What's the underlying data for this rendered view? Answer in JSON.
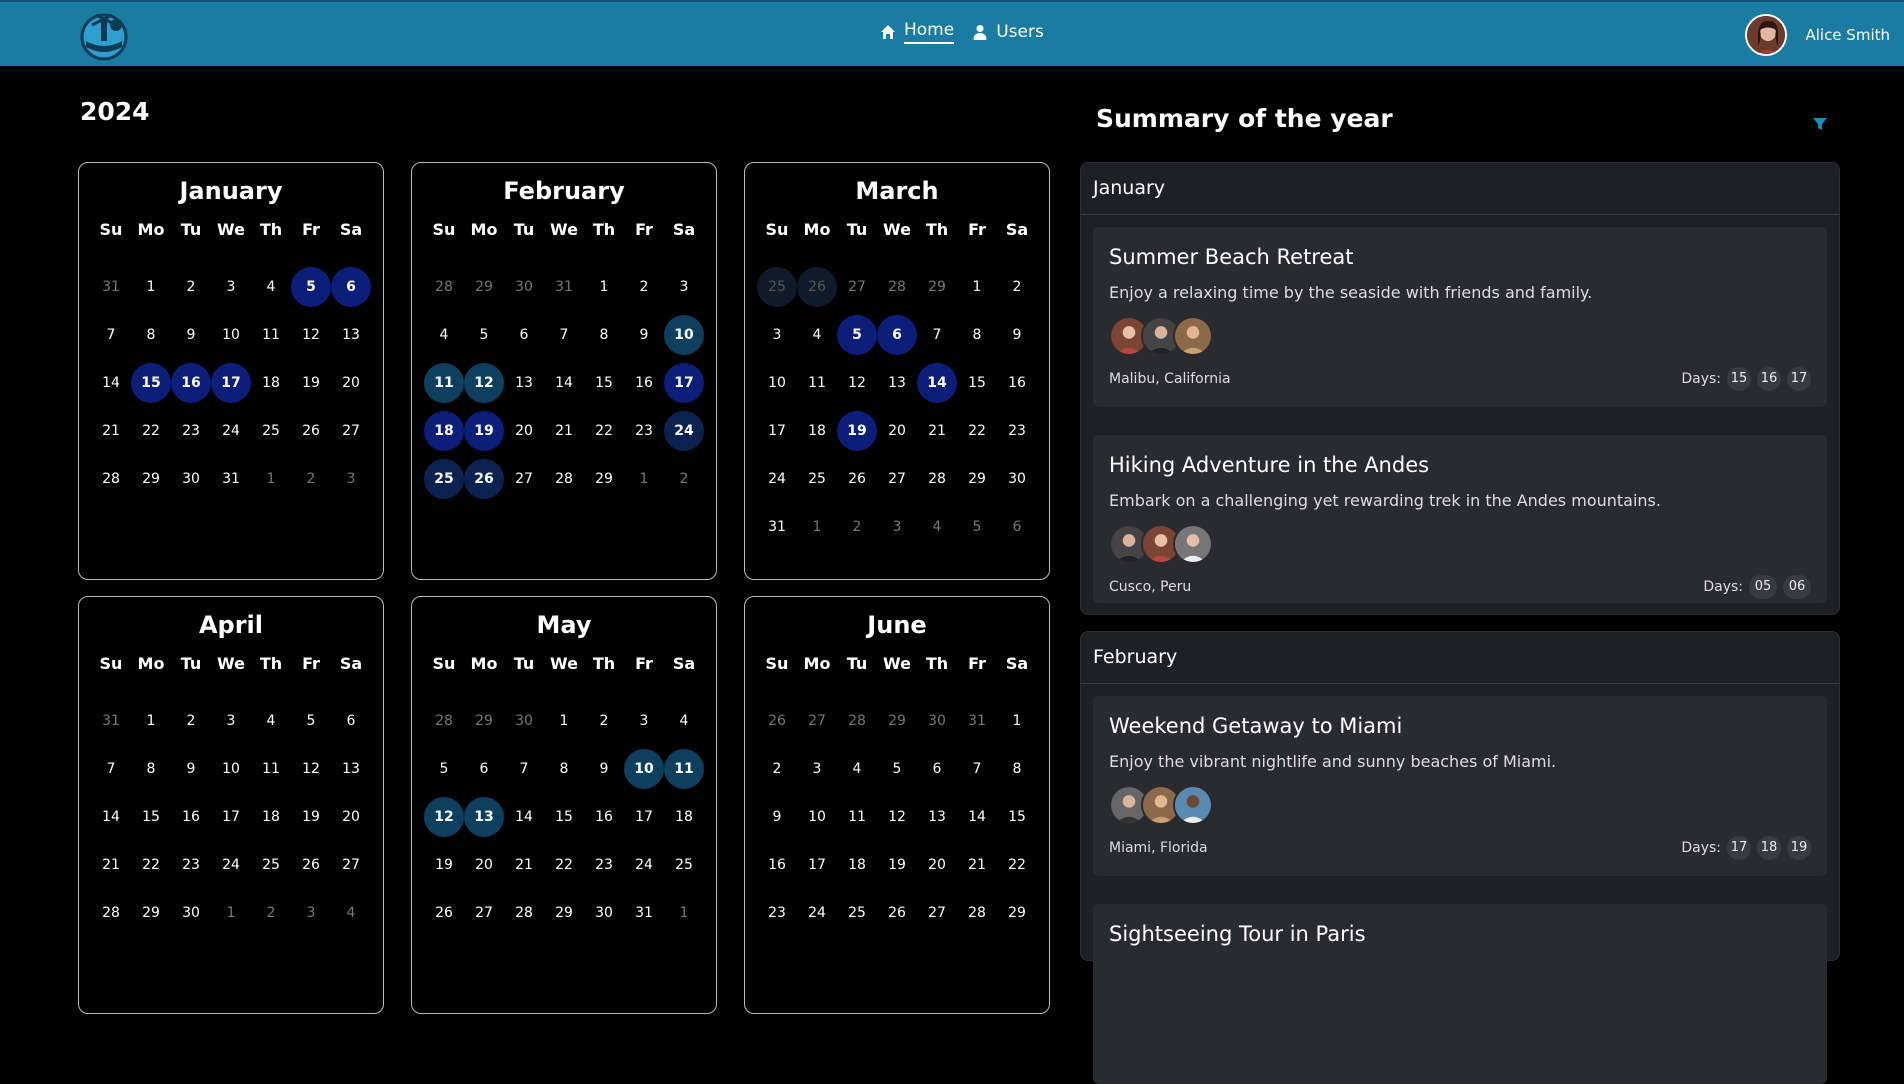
{
  "nav": {
    "home_label": "Home",
    "users_label": "Users",
    "user_name": "Alice Smith"
  },
  "calendar": {
    "year": "2024",
    "weekdays": [
      "Su",
      "Mo",
      "Tu",
      "We",
      "Th",
      "Fr",
      "Sa"
    ],
    "months": [
      {
        "name": "January",
        "weeks": [
          [
            [
              "31",
              "m"
            ],
            [
              "1",
              ""
            ],
            [
              "2",
              ""
            ],
            [
              "3",
              ""
            ],
            [
              "4",
              ""
            ],
            [
              "5",
              "b"
            ],
            [
              "6",
              "b"
            ]
          ],
          [
            [
              "7",
              ""
            ],
            [
              "8",
              ""
            ],
            [
              "9",
              ""
            ],
            [
              "10",
              ""
            ],
            [
              "11",
              ""
            ],
            [
              "12",
              ""
            ],
            [
              "13",
              ""
            ]
          ],
          [
            [
              "14",
              ""
            ],
            [
              "15",
              "b"
            ],
            [
              "16",
              "b"
            ],
            [
              "17",
              "b"
            ],
            [
              "18",
              ""
            ],
            [
              "19",
              ""
            ],
            [
              "20",
              ""
            ]
          ],
          [
            [
              "21",
              ""
            ],
            [
              "22",
              ""
            ],
            [
              "23",
              ""
            ],
            [
              "24",
              ""
            ],
            [
              "25",
              ""
            ],
            [
              "26",
              ""
            ],
            [
              "27",
              ""
            ]
          ],
          [
            [
              "28",
              ""
            ],
            [
              "29",
              ""
            ],
            [
              "30",
              ""
            ],
            [
              "31",
              ""
            ],
            [
              "1",
              "m"
            ],
            [
              "2",
              "m"
            ],
            [
              "3",
              "m"
            ]
          ]
        ]
      },
      {
        "name": "February",
        "weeks": [
          [
            [
              "28",
              "m"
            ],
            [
              "29",
              "m"
            ],
            [
              "30",
              "m"
            ],
            [
              "31",
              "m"
            ],
            [
              "1",
              ""
            ],
            [
              "2",
              ""
            ],
            [
              "3",
              ""
            ]
          ],
          [
            [
              "4",
              ""
            ],
            [
              "5",
              ""
            ],
            [
              "6",
              ""
            ],
            [
              "7",
              ""
            ],
            [
              "8",
              ""
            ],
            [
              "9",
              ""
            ],
            [
              "10",
              "t"
            ]
          ],
          [
            [
              "11",
              "t"
            ],
            [
              "12",
              "t"
            ],
            [
              "13",
              ""
            ],
            [
              "14",
              ""
            ],
            [
              "15",
              ""
            ],
            [
              "16",
              ""
            ],
            [
              "17",
              "b"
            ]
          ],
          [
            [
              "18",
              "b"
            ],
            [
              "19",
              "b"
            ],
            [
              "20",
              ""
            ],
            [
              "21",
              ""
            ],
            [
              "22",
              ""
            ],
            [
              "23",
              ""
            ],
            [
              "24",
              "n"
            ]
          ],
          [
            [
              "25",
              "n"
            ],
            [
              "26",
              "n"
            ],
            [
              "27",
              ""
            ],
            [
              "28",
              ""
            ],
            [
              "29",
              ""
            ],
            [
              "1",
              "m"
            ],
            [
              "2",
              "m"
            ]
          ]
        ]
      },
      {
        "name": "March",
        "weeks": [
          [
            [
              "25",
              "f"
            ],
            [
              "26",
              "f"
            ],
            [
              "27",
              "m"
            ],
            [
              "28",
              "m"
            ],
            [
              "29",
              "m"
            ],
            [
              "1",
              ""
            ],
            [
              "2",
              ""
            ]
          ],
          [
            [
              "3",
              ""
            ],
            [
              "4",
              ""
            ],
            [
              "5",
              "b"
            ],
            [
              "6",
              "b"
            ],
            [
              "7",
              ""
            ],
            [
              "8",
              ""
            ],
            [
              "9",
              ""
            ]
          ],
          [
            [
              "10",
              ""
            ],
            [
              "11",
              ""
            ],
            [
              "12",
              ""
            ],
            [
              "13",
              ""
            ],
            [
              "14",
              "b"
            ],
            [
              "15",
              ""
            ],
            [
              "16",
              ""
            ]
          ],
          [
            [
              "17",
              ""
            ],
            [
              "18",
              ""
            ],
            [
              "19",
              "b"
            ],
            [
              "20",
              ""
            ],
            [
              "21",
              ""
            ],
            [
              "22",
              ""
            ],
            [
              "23",
              ""
            ]
          ],
          [
            [
              "24",
              ""
            ],
            [
              "25",
              ""
            ],
            [
              "26",
              ""
            ],
            [
              "27",
              ""
            ],
            [
              "28",
              ""
            ],
            [
              "29",
              ""
            ],
            [
              "30",
              ""
            ]
          ],
          [
            [
              "31",
              ""
            ],
            [
              "1",
              "m"
            ],
            [
              "2",
              "m"
            ],
            [
              "3",
              "m"
            ],
            [
              "4",
              "m"
            ],
            [
              "5",
              "m"
            ],
            [
              "6",
              "m"
            ]
          ]
        ]
      },
      {
        "name": "April",
        "weeks": [
          [
            [
              "31",
              "m"
            ],
            [
              "1",
              ""
            ],
            [
              "2",
              ""
            ],
            [
              "3",
              ""
            ],
            [
              "4",
              ""
            ],
            [
              "5",
              ""
            ],
            [
              "6",
              ""
            ]
          ],
          [
            [
              "7",
              ""
            ],
            [
              "8",
              ""
            ],
            [
              "9",
              ""
            ],
            [
              "10",
              ""
            ],
            [
              "11",
              ""
            ],
            [
              "12",
              ""
            ],
            [
              "13",
              ""
            ]
          ],
          [
            [
              "14",
              ""
            ],
            [
              "15",
              ""
            ],
            [
              "16",
              ""
            ],
            [
              "17",
              ""
            ],
            [
              "18",
              ""
            ],
            [
              "19",
              ""
            ],
            [
              "20",
              ""
            ]
          ],
          [
            [
              "21",
              ""
            ],
            [
              "22",
              ""
            ],
            [
              "23",
              ""
            ],
            [
              "24",
              ""
            ],
            [
              "25",
              ""
            ],
            [
              "26",
              ""
            ],
            [
              "27",
              ""
            ]
          ],
          [
            [
              "28",
              ""
            ],
            [
              "29",
              ""
            ],
            [
              "30",
              ""
            ],
            [
              "1",
              "m"
            ],
            [
              "2",
              "m"
            ],
            [
              "3",
              "m"
            ],
            [
              "4",
              "m"
            ]
          ]
        ]
      },
      {
        "name": "May",
        "weeks": [
          [
            [
              "28",
              "m"
            ],
            [
              "29",
              "m"
            ],
            [
              "30",
              "m"
            ],
            [
              "1",
              ""
            ],
            [
              "2",
              ""
            ],
            [
              "3",
              ""
            ],
            [
              "4",
              ""
            ]
          ],
          [
            [
              "5",
              ""
            ],
            [
              "6",
              ""
            ],
            [
              "7",
              ""
            ],
            [
              "8",
              ""
            ],
            [
              "9",
              ""
            ],
            [
              "10",
              "t"
            ],
            [
              "11",
              "t"
            ]
          ],
          [
            [
              "12",
              "t"
            ],
            [
              "13",
              "t"
            ],
            [
              "14",
              ""
            ],
            [
              "15",
              ""
            ],
            [
              "16",
              ""
            ],
            [
              "17",
              ""
            ],
            [
              "18",
              ""
            ]
          ],
          [
            [
              "19",
              ""
            ],
            [
              "20",
              ""
            ],
            [
              "21",
              ""
            ],
            [
              "22",
              ""
            ],
            [
              "23",
              ""
            ],
            [
              "24",
              ""
            ],
            [
              "25",
              ""
            ]
          ],
          [
            [
              "26",
              ""
            ],
            [
              "27",
              ""
            ],
            [
              "28",
              ""
            ],
            [
              "29",
              ""
            ],
            [
              "30",
              ""
            ],
            [
              "31",
              ""
            ],
            [
              "1",
              "m"
            ]
          ]
        ]
      },
      {
        "name": "June",
        "weeks": [
          [
            [
              "26",
              "m"
            ],
            [
              "27",
              "m"
            ],
            [
              "28",
              "m"
            ],
            [
              "29",
              "m"
            ],
            [
              "30",
              "m"
            ],
            [
              "31",
              "m"
            ],
            [
              "1",
              ""
            ]
          ],
          [
            [
              "2",
              ""
            ],
            [
              "3",
              ""
            ],
            [
              "4",
              ""
            ],
            [
              "5",
              ""
            ],
            [
              "6",
              ""
            ],
            [
              "7",
              ""
            ],
            [
              "8",
              ""
            ]
          ],
          [
            [
              "9",
              ""
            ],
            [
              "10",
              ""
            ],
            [
              "11",
              ""
            ],
            [
              "12",
              ""
            ],
            [
              "13",
              ""
            ],
            [
              "14",
              ""
            ],
            [
              "15",
              ""
            ]
          ],
          [
            [
              "16",
              ""
            ],
            [
              "17",
              ""
            ],
            [
              "18",
              ""
            ],
            [
              "19",
              ""
            ],
            [
              "20",
              ""
            ],
            [
              "21",
              ""
            ],
            [
              "22",
              ""
            ]
          ],
          [
            [
              "23",
              ""
            ],
            [
              "24",
              ""
            ],
            [
              "25",
              ""
            ],
            [
              "26",
              ""
            ],
            [
              "27",
              ""
            ],
            [
              "28",
              ""
            ],
            [
              "29",
              ""
            ]
          ]
        ]
      }
    ]
  },
  "summary": {
    "title": "Summary of the year",
    "january": {
      "label": "January",
      "trips": [
        {
          "title": "Summer Beach Retreat",
          "desc": "Enjoy a relaxing time by the seaside with friends and family.",
          "location": "Malibu, California",
          "days_label": "Days:",
          "days": [
            "15",
            "16",
            "17"
          ]
        },
        {
          "title": "Hiking Adventure in the Andes",
          "desc": "Embark on a challenging yet rewarding trek in the Andes mountains.",
          "location": "Cusco, Peru",
          "days_label": "Days:",
          "days": [
            "05",
            "06"
          ]
        }
      ]
    },
    "february": {
      "label": "February",
      "trips": [
        {
          "title": "Weekend Getaway to Miami",
          "desc": "Enjoy the vibrant nightlife and sunny beaches of Miami.",
          "location": "Miami, Florida",
          "days_label": "Days:",
          "days": [
            "17",
            "18",
            "19"
          ]
        },
        {
          "title": "Sightseeing Tour in Paris"
        }
      ]
    }
  }
}
